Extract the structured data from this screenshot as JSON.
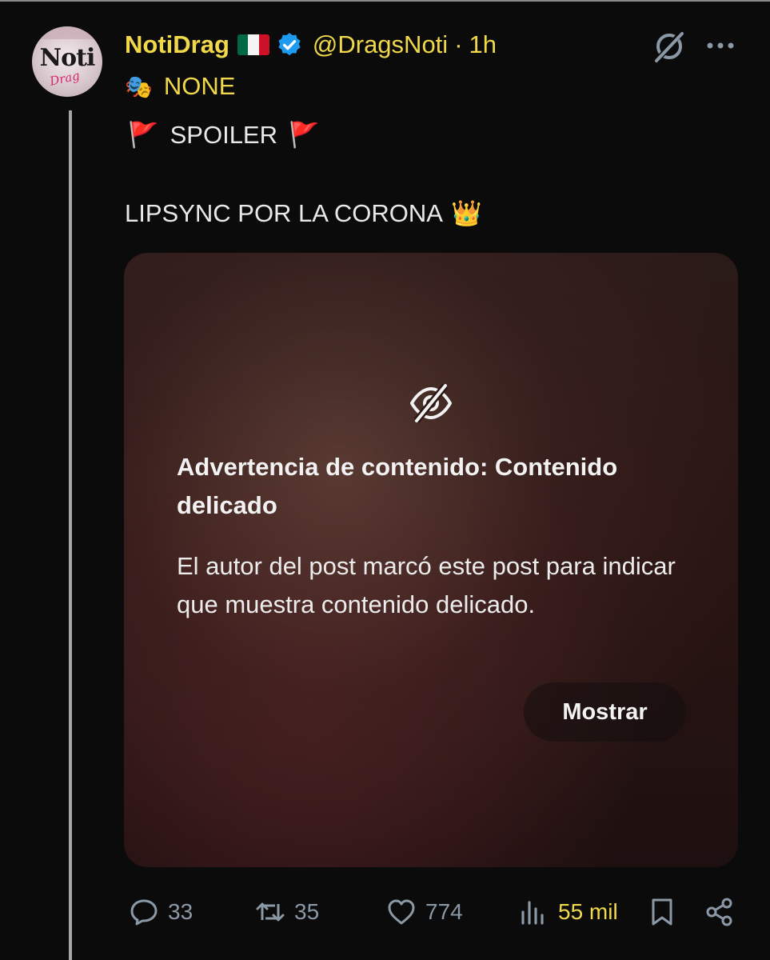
{
  "post": {
    "author_name": "NotiDrag",
    "author_handle": "@DragsNoti",
    "separator": "·",
    "time": "1h",
    "avatar_text_main": "Noti",
    "avatar_text_sub": "Drag",
    "line1_emoji": "🎭",
    "line1_text": "NONE",
    "line2_flag_left": "🚩",
    "line2_text": "SPOILER",
    "line2_flag_right": "🚩",
    "line3_text": "LIPSYNC POR LA CORONA",
    "line3_emoji": "👑"
  },
  "media_warning": {
    "title": "Advertencia de contenido: Contenido delicado",
    "body": "El autor del post marcó este post para indicar que muestra contenido delicado.",
    "show_button": "Mostrar"
  },
  "actions": {
    "replies": "33",
    "reposts": "35",
    "likes": "774",
    "views": "55 mil"
  },
  "colors": {
    "name_accent": "#f0d84a",
    "background": "#0b0b0b",
    "verified_badge": "#1d9bf0",
    "muted_icon": "#8b98a5"
  },
  "icons": {
    "header": [
      "mexico-flag-icon",
      "verified-badge-icon",
      "grok-icon",
      "more-icon"
    ],
    "media": [
      "eye-slash-icon"
    ],
    "actions": [
      "reply-icon",
      "repost-icon",
      "like-icon",
      "views-icon",
      "bookmark-icon",
      "share-icon"
    ]
  }
}
